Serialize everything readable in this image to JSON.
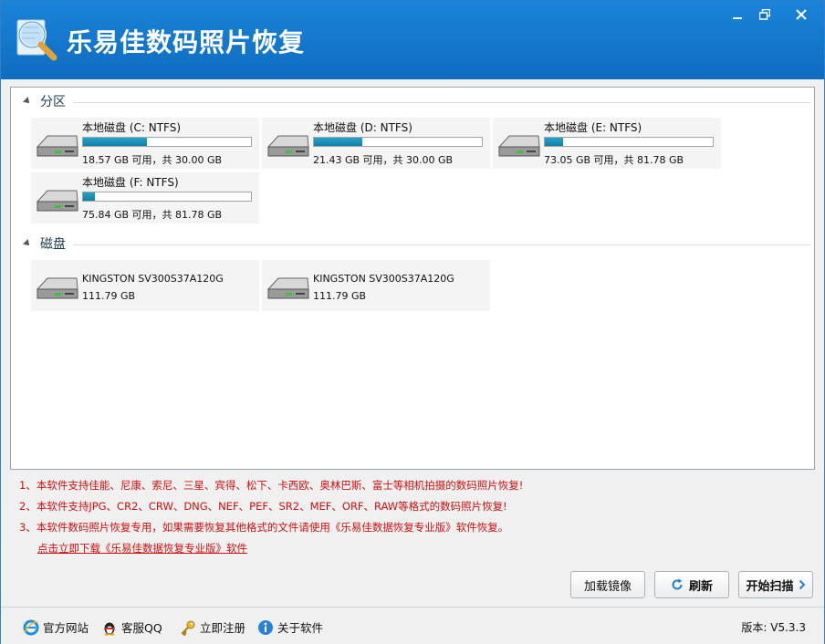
{
  "app": {
    "title": "乐易佳数码照片恢复"
  },
  "window_controls": {
    "minimize": "minimize",
    "restore": "restore",
    "close": "close"
  },
  "groups": {
    "partitions": {
      "title": "分区"
    },
    "disks": {
      "title": "磁盘"
    }
  },
  "partitions": [
    {
      "name": "本地磁盘 (C: NTFS)",
      "info": "18.57 GB 可用，共 30.00 GB",
      "used_fraction": 0.381
    },
    {
      "name": "本地磁盘 (D: NTFS)",
      "info": "21.43 GB 可用，共 30.00 GB",
      "used_fraction": 0.286
    },
    {
      "name": "本地磁盘 (E: NTFS)",
      "info": "73.05 GB 可用，共 81.78 GB",
      "used_fraction": 0.107
    },
    {
      "name": "本地磁盘 (F: NTFS)",
      "info": "75.84 GB 可用，共 81.78 GB",
      "used_fraction": 0.073
    }
  ],
  "disks": [
    {
      "name": "KINGSTON SV300S37A120G",
      "info": "111.79 GB"
    },
    {
      "name": "KINGSTON SV300S37A120G",
      "info": "111.79 GB"
    }
  ],
  "notes": [
    "1、本软件支持佳能、尼康、索尼、三星、宾得、松下、卡西欧、奥林巴斯、富士等相机拍摄的数码照片恢复!",
    "2、本软件支持JPG、CR2、CRW、DNG、NEF、PEF、SR2、MEF、ORF、RAW等格式的数码照片恢复!",
    "3、本软件数码照片恢复专用，如果需要恢复其他格式的文件请使用《乐易佳数据恢复专业版》软件恢复。"
  ],
  "download_link": "点击立即下载《乐易佳数据恢复专业版》软件",
  "buttons": {
    "load_image": "加载镜像",
    "refresh": "刷新",
    "start_scan": "开始扫描"
  },
  "statusbar": {
    "website": "官方网站",
    "support_qq": "客服QQ",
    "register": "立即注册",
    "about": "关于软件",
    "version": "版本: V5.3.3"
  },
  "colors": {
    "title_bar": "#1173c8",
    "usage_bar": "#1d91b9",
    "notes_text": "#cc1010"
  }
}
